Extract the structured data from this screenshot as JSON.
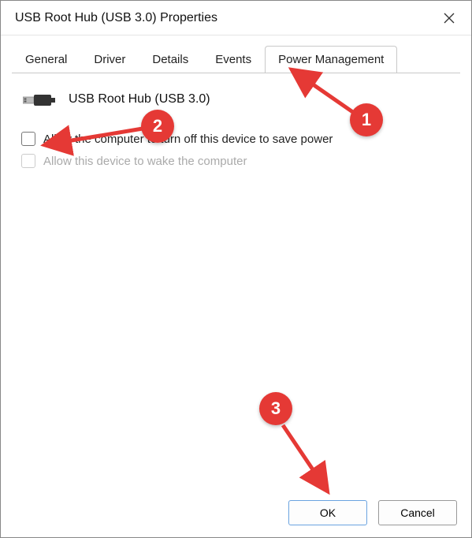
{
  "window": {
    "title": "USB Root Hub (USB 3.0) Properties"
  },
  "tabs": [
    {
      "label": "General"
    },
    {
      "label": "Driver"
    },
    {
      "label": "Details"
    },
    {
      "label": "Events"
    },
    {
      "label": "Power Management"
    }
  ],
  "active_tab_index": 4,
  "device": {
    "name": "USB Root Hub (USB 3.0)"
  },
  "options": {
    "turn_off_label": "Allow the computer to turn off this device to save power",
    "turn_off_checked": false,
    "wake_label": "Allow this device to wake the computer",
    "wake_checked": false,
    "wake_enabled": false
  },
  "buttons": {
    "ok": "OK",
    "cancel": "Cancel"
  },
  "annotations": {
    "one": "1",
    "two": "2",
    "three": "3"
  },
  "colors": {
    "annotation": "#e53935"
  }
}
